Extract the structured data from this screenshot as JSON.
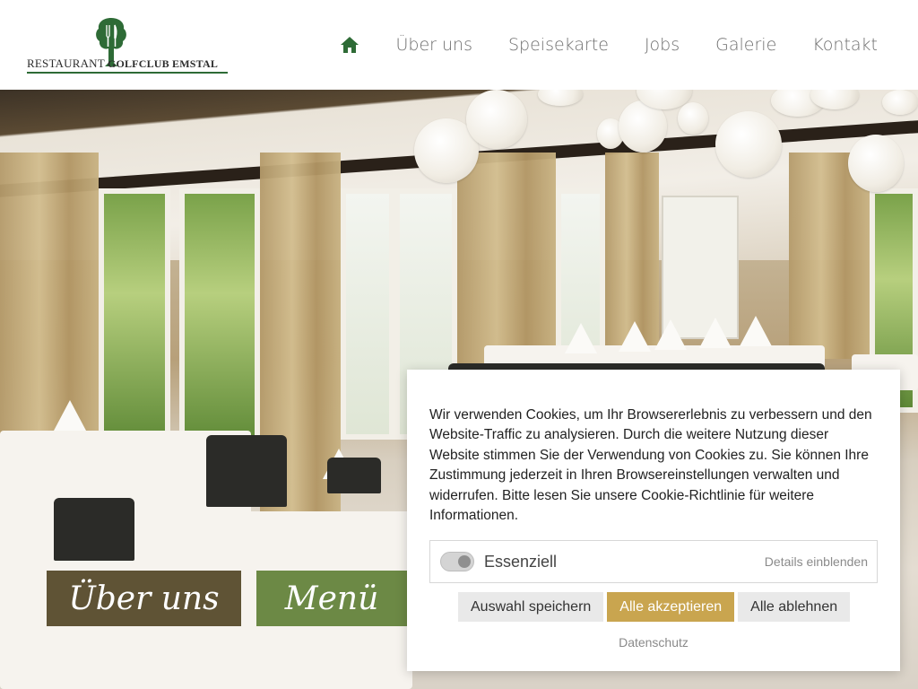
{
  "logo": {
    "word1": "RESTAURANT",
    "word2": "GOLFCLUB EMSTAL",
    "tree_icon": "tree-fork-knife-icon",
    "tree_color": "#2e6b36"
  },
  "nav": {
    "home_icon": "home-icon",
    "home_color": "#2e6b36",
    "items": [
      "Über uns",
      "Speisekarte",
      "Jobs",
      "Galerie",
      "Kontakt"
    ]
  },
  "hero": {
    "buttons": {
      "about": "Über uns",
      "menu": "Menü"
    },
    "colors": {
      "about_bg": "#5f5335",
      "menu_bg": "#6c8945"
    }
  },
  "cookie": {
    "text": "Wir verwenden Cookies, um Ihr Browsererlebnis zu verbessern und den Website-Traffic zu analysieren. Durch die weitere Nutzung dieser Website stimmen Sie der Verwendung von Cookies zu. Sie können Ihre Zustimmung jederzeit in Ihren Browsereinstellungen verwalten und widerrufen. Bitte lesen Sie unsere Cookie-Richtlinie für weitere Informationen.",
    "category_label": "Essenziell",
    "details_link": "Details einblenden",
    "buttons": {
      "save": "Auswahl speichern",
      "accept_all": "Alle akzeptieren",
      "reject_all": "Alle ablehnen"
    },
    "privacy_link": "Datenschutz",
    "accent_color": "#c9a54f"
  }
}
